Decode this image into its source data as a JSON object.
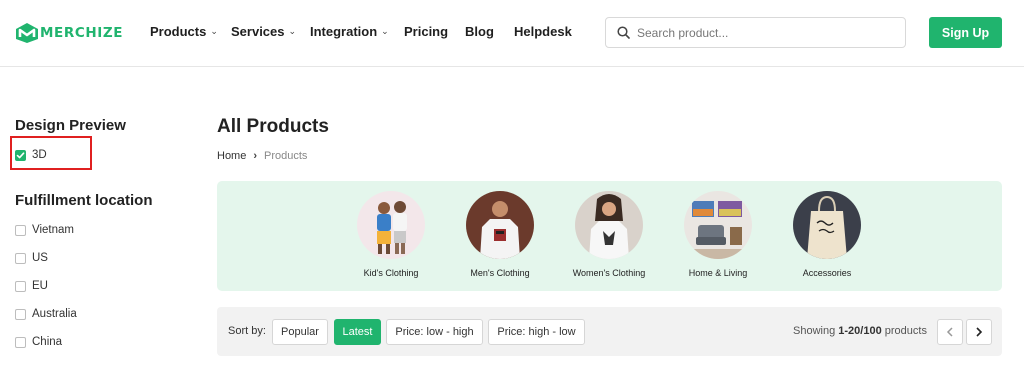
{
  "header": {
    "logo_text": "MERCHIZE",
    "nav": [
      {
        "label": "Products",
        "has_dropdown": true
      },
      {
        "label": "Services",
        "has_dropdown": true
      },
      {
        "label": "Integration",
        "has_dropdown": true
      },
      {
        "label": "Pricing",
        "has_dropdown": false
      },
      {
        "label": "Blog",
        "has_dropdown": false
      },
      {
        "label": "Helpdesk",
        "has_dropdown": false
      }
    ],
    "search_placeholder": "Search product...",
    "signup_label": "Sign Up"
  },
  "sidebar": {
    "design_preview": {
      "heading": "Design Preview",
      "options": [
        {
          "label": "3D",
          "checked": true
        }
      ]
    },
    "fulfillment": {
      "heading": "Fulfillment location",
      "options": [
        {
          "label": "Vietnam",
          "checked": false
        },
        {
          "label": "US",
          "checked": false
        },
        {
          "label": "EU",
          "checked": false
        },
        {
          "label": "Australia",
          "checked": false
        },
        {
          "label": "China",
          "checked": false
        }
      ]
    }
  },
  "main": {
    "title": "All Products",
    "breadcrumb": {
      "home": "Home",
      "current": "Products"
    },
    "categories": [
      {
        "label": "Kid's Clothing"
      },
      {
        "label": "Men's Clothing"
      },
      {
        "label": "Women's Clothing"
      },
      {
        "label": "Home & Living"
      },
      {
        "label": "Accessories"
      }
    ],
    "sort": {
      "label": "Sort by:",
      "options": [
        {
          "label": "Popular",
          "active": false
        },
        {
          "label": "Latest",
          "active": true
        },
        {
          "label": "Price: low - high",
          "active": false
        },
        {
          "label": "Price: high - low",
          "active": false
        }
      ],
      "showing_prefix": "Showing",
      "showing_range": "1-20/100",
      "showing_suffix": "products"
    }
  },
  "colors": {
    "brand": "#20b46e",
    "panel_bg": "#e4f6ec",
    "highlight": "#e02020"
  }
}
